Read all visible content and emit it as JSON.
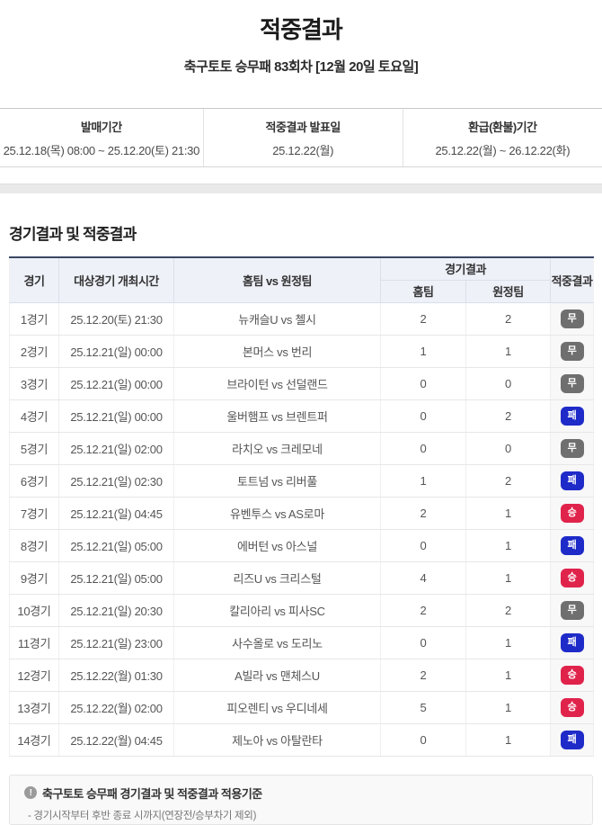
{
  "page": {
    "title": "적중결과",
    "subtitle": "축구토토 승무패 83회차 [12월 20일 토요일]"
  },
  "info_bar": {
    "items": [
      {
        "label": "발매기간",
        "value": "25.12.18(목) 08:00 ~ 25.12.20(토) 21:30"
      },
      {
        "label": "적중결과 발표일",
        "value": "25.12.22(월)"
      },
      {
        "label": "환급(환불)기간",
        "value": "25.12.22(월) ~ 26.12.22(화)"
      }
    ]
  },
  "section": {
    "title": "경기결과 및 적중결과"
  },
  "table": {
    "headers": {
      "game": "경기",
      "datetime": "대상경기 개최시간",
      "teams": "홈팀 vs 원정팀",
      "result_group": "경기결과",
      "home": "홈팀",
      "away": "원정팀",
      "hit": "적중결과"
    },
    "rows": [
      {
        "game": "1경기",
        "datetime": "25.12.20(토) 21:30",
        "teams": "뉴캐슬U vs 첼시",
        "home": "2",
        "away": "2",
        "result": "무",
        "result_type": "draw"
      },
      {
        "game": "2경기",
        "datetime": "25.12.21(일) 00:00",
        "teams": "본머스 vs 번리",
        "home": "1",
        "away": "1",
        "result": "무",
        "result_type": "draw"
      },
      {
        "game": "3경기",
        "datetime": "25.12.21(일) 00:00",
        "teams": "브라이턴 vs 선덜랜드",
        "home": "0",
        "away": "0",
        "result": "무",
        "result_type": "draw"
      },
      {
        "game": "4경기",
        "datetime": "25.12.21(일) 00:00",
        "teams": "울버햄프 vs 브렌트퍼",
        "home": "0",
        "away": "2",
        "result": "패",
        "result_type": "lose"
      },
      {
        "game": "5경기",
        "datetime": "25.12.21(일) 02:00",
        "teams": "라치오 vs 크레모네",
        "home": "0",
        "away": "0",
        "result": "무",
        "result_type": "draw"
      },
      {
        "game": "6경기",
        "datetime": "25.12.21(일) 02:30",
        "teams": "토트넘 vs 리버풀",
        "home": "1",
        "away": "2",
        "result": "패",
        "result_type": "lose"
      },
      {
        "game": "7경기",
        "datetime": "25.12.21(일) 04:45",
        "teams": "유벤투스 vs AS로마",
        "home": "2",
        "away": "1",
        "result": "승",
        "result_type": "win"
      },
      {
        "game": "8경기",
        "datetime": "25.12.21(일) 05:00",
        "teams": "에버턴 vs 아스널",
        "home": "0",
        "away": "1",
        "result": "패",
        "result_type": "lose"
      },
      {
        "game": "9경기",
        "datetime": "25.12.21(일) 05:00",
        "teams": "리즈U vs 크리스털",
        "home": "4",
        "away": "1",
        "result": "승",
        "result_type": "win"
      },
      {
        "game": "10경기",
        "datetime": "25.12.21(일) 20:30",
        "teams": "칼리아리 vs 피사SC",
        "home": "2",
        "away": "2",
        "result": "무",
        "result_type": "draw"
      },
      {
        "game": "11경기",
        "datetime": "25.12.21(일) 23:00",
        "teams": "사수올로 vs 도리노",
        "home": "0",
        "away": "1",
        "result": "패",
        "result_type": "lose"
      },
      {
        "game": "12경기",
        "datetime": "25.12.22(월) 01:30",
        "teams": "A빌라 vs 맨체스U",
        "home": "2",
        "away": "1",
        "result": "승",
        "result_type": "win"
      },
      {
        "game": "13경기",
        "datetime": "25.12.22(월) 02:00",
        "teams": "피오렌티 vs 우디네세",
        "home": "5",
        "away": "1",
        "result": "승",
        "result_type": "win"
      },
      {
        "game": "14경기",
        "datetime": "25.12.22(월) 04:45",
        "teams": "제노아 vs 아탈란타",
        "home": "0",
        "away": "1",
        "result": "패",
        "result_type": "lose"
      }
    ]
  },
  "footnote": {
    "icon_glyph": "!",
    "title": "축구토토 승무패 경기결과 및 적중결과 적용기준",
    "line": "- 경기시작부터 후반 종료 시까지(연장전/승부차기 제외)"
  },
  "colors": {
    "win_badge": "#e0234b",
    "lose_badge": "#1e2bc8",
    "draw_badge": "#6f6f6f",
    "header_bg": "#eef1f8",
    "table_top_border": "#3a4764"
  }
}
